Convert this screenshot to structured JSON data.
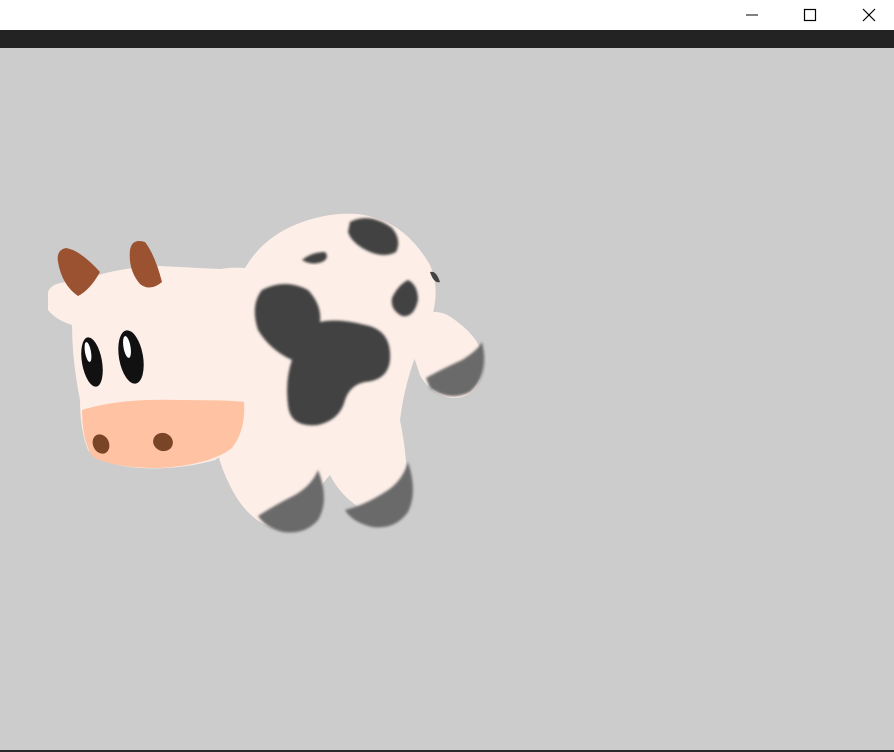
{
  "window": {
    "controls": {
      "minimize_icon": "minimize-icon",
      "maximize_icon": "maximize-icon",
      "close_icon": "close-icon"
    }
  },
  "scene": {
    "subject": "cow",
    "background_color": "#cccccc",
    "colors": {
      "body": "#fdeee8",
      "spots": "#424242",
      "hooves": "#6b6b6b",
      "horns": "#9b5230",
      "snout": "#ffc3a3",
      "nostrils": "#7a4426",
      "eyes": "#111111"
    }
  }
}
